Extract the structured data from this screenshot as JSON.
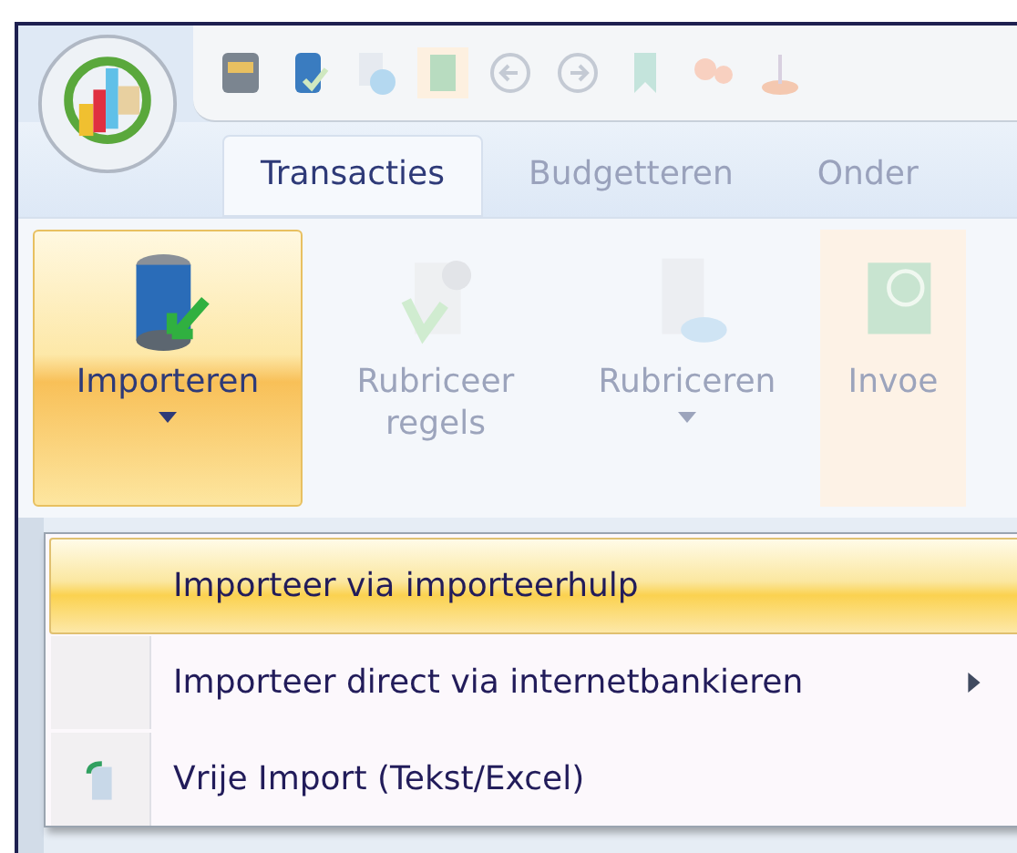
{
  "tabs": [
    {
      "label": "Transacties",
      "selected": true
    },
    {
      "label": "Budgetteren",
      "selected": false
    },
    {
      "label": "Onder",
      "selected": false
    }
  ],
  "ribbon": {
    "buttons": [
      {
        "label": "Importeren",
        "pressed": true,
        "disabled": false,
        "dropdown": true
      },
      {
        "label": "Rubriceer regels",
        "pressed": false,
        "disabled": true,
        "dropdown": false
      },
      {
        "label": "Rubriceren",
        "pressed": false,
        "disabled": true,
        "dropdown": true
      },
      {
        "label": "Invoe",
        "pressed": false,
        "disabled": true,
        "dropdown": false
      }
    ]
  },
  "menu": {
    "items": [
      {
        "label": "Importeer via importeerhulp",
        "selected": true,
        "kind": "plain"
      },
      {
        "label": "Importeer direct via internetbankieren",
        "selected": false,
        "kind": "submenu"
      },
      {
        "label": "Vrije Import (Tekst/Excel)",
        "selected": false,
        "kind": "icon"
      }
    ]
  }
}
